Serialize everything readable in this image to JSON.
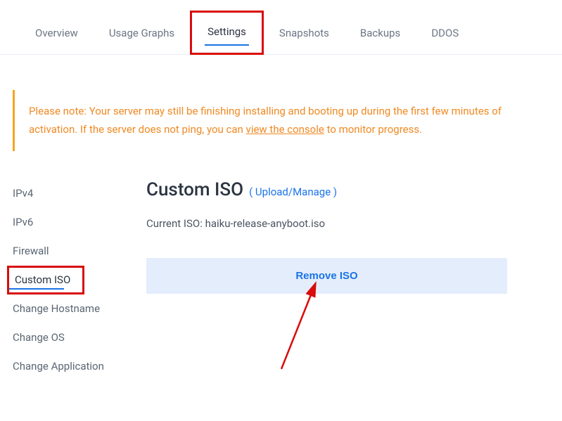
{
  "tabs": {
    "overview": "Overview",
    "usage": "Usage Graphs",
    "settings": "Settings",
    "snapshots": "Snapshots",
    "backups": "Backups",
    "ddos": "DDOS"
  },
  "alert": {
    "line1_pre": "Please note: Your server may still be finishing installing and booting up during the first few minutes of activation. ",
    "line2_pre": "If the server does not ping, you can ",
    "link": "view the console",
    "line2_post": " to monitor progress."
  },
  "sidebar": {
    "ipv4": "IPv4",
    "ipv6": "IPv6",
    "firewall": "Firewall",
    "custom_iso": "Custom ISO",
    "change_hostname": "Change Hostname",
    "change_os": "Change OS",
    "change_app": "Change Application"
  },
  "main": {
    "title": "Custom ISO",
    "upload_link": "( Upload/Manage )",
    "current_label": "Current ISO: ",
    "current_value": "haiku-release-anyboot.iso",
    "remove_btn": "Remove ISO"
  }
}
